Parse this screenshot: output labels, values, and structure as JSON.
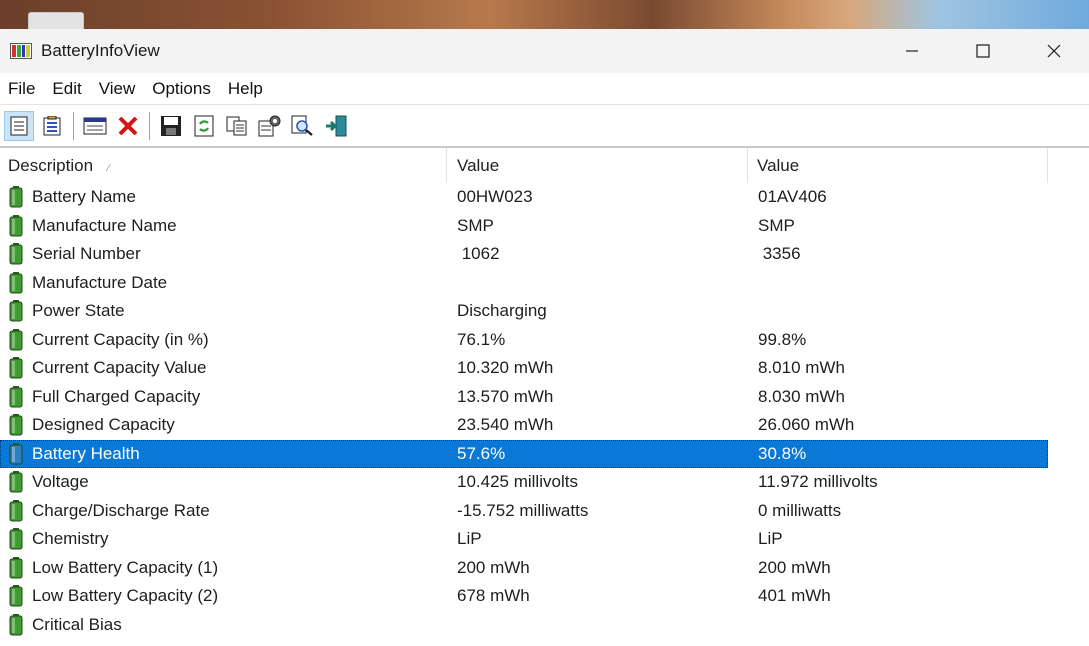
{
  "window": {
    "title": "BatteryInfoView",
    "controls": {
      "minimize": "—",
      "maximize": "☐",
      "close": "✕"
    }
  },
  "menu": [
    "File",
    "Edit",
    "View",
    "Options",
    "Help"
  ],
  "toolbar": {
    "buttons": [
      {
        "name": "properties-view-icon",
        "active": true
      },
      {
        "name": "log-view-icon",
        "active": false
      },
      {
        "name": "window-icon",
        "active": false
      },
      {
        "name": "delete-icon",
        "active": false
      },
      {
        "name": "save-icon",
        "active": false
      },
      {
        "name": "refresh-icon",
        "active": false
      },
      {
        "name": "copy-icon",
        "active": false
      },
      {
        "name": "options-icon",
        "active": false
      },
      {
        "name": "find-icon",
        "active": false
      },
      {
        "name": "exit-icon",
        "active": false
      }
    ]
  },
  "table": {
    "headers": [
      "Description",
      "Value",
      "Value"
    ],
    "sort_indicator": "⁄",
    "selected_row": 9,
    "rows": [
      [
        "Battery Name",
        "00HW023",
        "01AV406"
      ],
      [
        "Manufacture Name",
        "SMP",
        "SMP"
      ],
      [
        "Serial Number",
        " 1062",
        " 3356"
      ],
      [
        "Manufacture Date",
        "",
        ""
      ],
      [
        "Power State",
        "Discharging",
        ""
      ],
      [
        "Current Capacity (in %)",
        "76.1%",
        "99.8%"
      ],
      [
        "Current Capacity Value",
        "10.320 mWh",
        "8.010 mWh"
      ],
      [
        "Full Charged Capacity",
        "13.570 mWh",
        "8.030 mWh"
      ],
      [
        "Designed Capacity",
        "23.540 mWh",
        "26.060 mWh"
      ],
      [
        "Battery Health",
        "57.6%",
        "30.8%"
      ],
      [
        "Voltage",
        "10.425 millivolts",
        "11.972 millivolts"
      ],
      [
        "Charge/Discharge Rate",
        "-15.752 milliwatts",
        "0 milliwatts"
      ],
      [
        "Chemistry",
        "LiP",
        "LiP"
      ],
      [
        "Low Battery Capacity (1)",
        "200 mWh",
        "200 mWh"
      ],
      [
        "Low Battery Capacity (2)",
        "678 mWh",
        "401 mWh"
      ],
      [
        "Critical Bias",
        "",
        ""
      ]
    ]
  },
  "colors": {
    "selection": "#0a78d7",
    "battery_green": "#3f9b2f",
    "battery_selected": "#2a7fc0"
  }
}
